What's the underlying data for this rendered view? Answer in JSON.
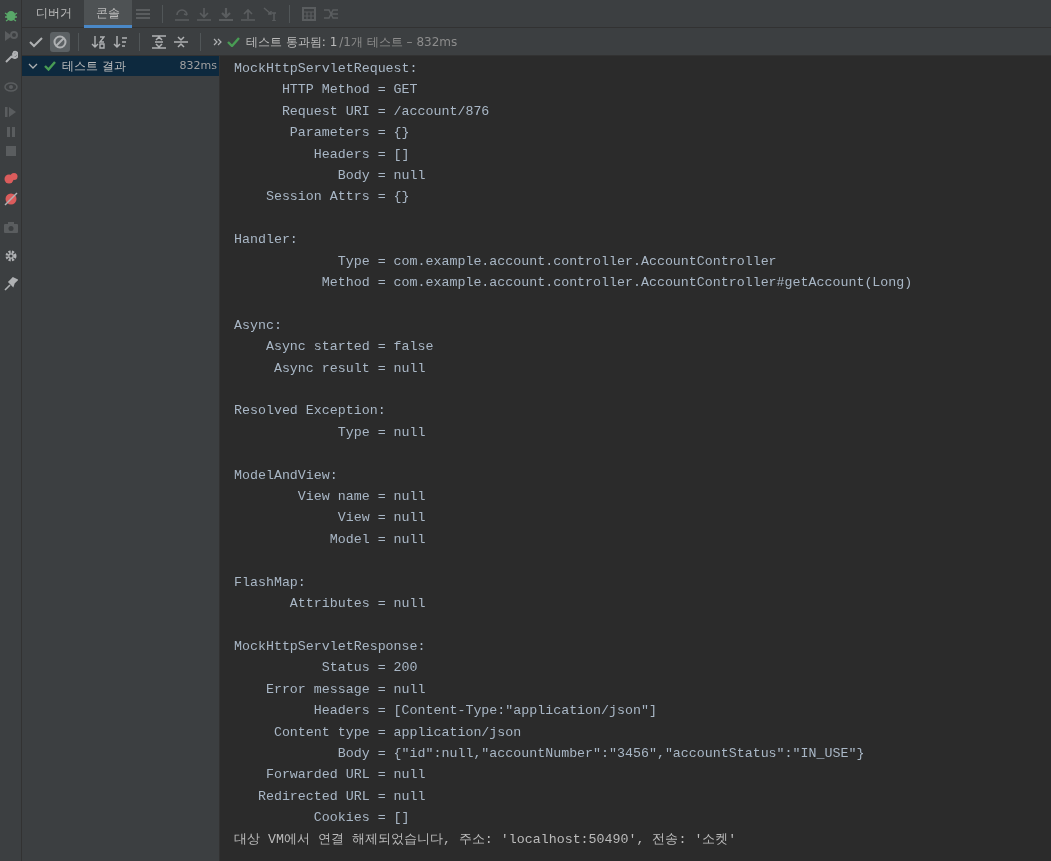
{
  "tabs": [
    {
      "label": "디버거",
      "selected": false
    },
    {
      "label": "콘솔",
      "selected": true
    }
  ],
  "filter_buttons": [
    {
      "selected": false
    },
    {
      "selected": true
    }
  ],
  "test_status": {
    "passed": true,
    "summary": "테스트 통과됨: 1",
    "detail": "/1개 테스트 – 832ms"
  },
  "tree": [
    {
      "label": "테스트 결과",
      "time": "832ms",
      "passed": true,
      "expanded": true,
      "selected": true
    }
  ],
  "console": {
    "blocks": [
      {
        "lines": [
          "MockHttpServletRequest:",
          "      HTTP Method = GET",
          "      Request URI = /account/876",
          "       Parameters = {}",
          "          Headers = []",
          "             Body = null",
          "    Session Attrs = {}"
        ]
      },
      {
        "lines": [
          "Handler:",
          "             Type = com.example.account.controller.AccountController",
          "           Method = com.example.account.controller.AccountController#getAccount(Long)"
        ]
      },
      {
        "lines": [
          "Async:",
          "    Async started = false",
          "     Async result = null"
        ]
      },
      {
        "lines": [
          "Resolved Exception:",
          "             Type = null"
        ]
      },
      {
        "lines": [
          "ModelAndView:",
          "        View name = null",
          "             View = null",
          "            Model = null"
        ]
      },
      {
        "lines": [
          "FlashMap:",
          "       Attributes = null"
        ]
      },
      {
        "lines": [
          "MockHttpServletResponse:",
          "           Status = 200",
          "    Error message = null",
          "          Headers = [Content-Type:\"application/json\"]",
          "     Content type = application/json",
          "             Body = {\"id\":null,\"accountNumber\":\"3456\",\"accountStatus\":\"IN_USE\"}",
          "    Forwarded URL = null",
          "   Redirected URL = null",
          "          Cookies = []"
        ]
      }
    ],
    "message": "대상 VM에서 연결 해제되었습니다, 주소: 'localhost:50490', 전송: '소켓'"
  }
}
